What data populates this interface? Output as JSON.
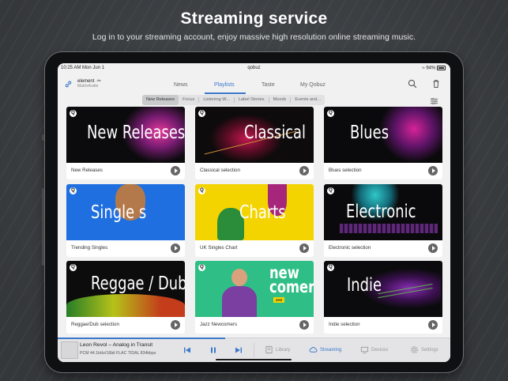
{
  "promo": {
    "title": "Streaming service",
    "subtitle": "Log in to your streaming account, enjoy massive high resolution online streaming music."
  },
  "status_bar": {
    "time": "10:25 AM   Mon Jun 1",
    "app_name": "qobuz",
    "battery": "94%"
  },
  "account": {
    "name": "element ·✂",
    "provider": "MatrixAudio"
  },
  "nav_tabs": [
    {
      "label": "News",
      "active": false
    },
    {
      "label": "Playlists",
      "active": true
    },
    {
      "label": "Taste",
      "active": false
    },
    {
      "label": "My Qobuz",
      "active": false
    }
  ],
  "filter_chips": [
    {
      "label": "New Releases",
      "selected": true
    },
    {
      "label": "Focus",
      "selected": false
    },
    {
      "label": "Listening W...",
      "selected": false
    },
    {
      "label": "Label Stories",
      "selected": false
    },
    {
      "label": "Moods",
      "selected": false
    },
    {
      "label": "Events and...",
      "selected": false
    }
  ],
  "playlists": [
    {
      "art_text": "New Releases",
      "caption": "New Releases",
      "bg": "#0b0b0d",
      "accent": "#e63a9a"
    },
    {
      "art_text": "Classical",
      "caption": "Classical selection",
      "bg": "#0d0b0b",
      "accent": "#c2184e"
    },
    {
      "art_text": "Blues",
      "caption": "Blues selection",
      "bg": "#0a0a0c",
      "accent": "#d6239a"
    },
    {
      "art_text": "Single s",
      "caption": "Trending Singles",
      "bg": "#1f6fe0",
      "accent": "#c47a3a"
    },
    {
      "art_text": "Charts",
      "caption": "UK Singles Chart",
      "bg": "#f4d400",
      "accent": "#2b8c3a"
    },
    {
      "art_text": "Electronic",
      "caption": "Electronic selection",
      "bg": "#0a0a0c",
      "accent": "#2fc7c7"
    },
    {
      "art_text": "Reggae / Dub",
      "caption": "Reggae/Dub selection",
      "bg": "#0c0c0c",
      "accent": "#c8d61a"
    },
    {
      "art_text": "new comers",
      "art_badge": "JAZ",
      "caption": "Jazz Newcomers",
      "bg": "#2fbf86",
      "accent": "#7a3fa1"
    },
    {
      "art_text": "Indie",
      "caption": "Indie selection",
      "bg": "#0b0b0d",
      "accent": "#8b2fb8"
    }
  ],
  "now_playing": {
    "title": "Leon Revol – Analog in Transit",
    "meta": "PCM  44.1kHz/16bit  FLAC  TIDAL  834kbps"
  },
  "bottom_tabs": [
    {
      "label": "Library",
      "icon": "library-icon",
      "active": false
    },
    {
      "label": "Streaming",
      "icon": "cloud-icon",
      "active": true
    },
    {
      "label": "Devices",
      "icon": "devices-icon",
      "active": false
    },
    {
      "label": "Settings",
      "icon": "gear-icon",
      "active": false
    }
  ],
  "colors": {
    "accent": "#3a78c9",
    "background": "#f1f1f2"
  }
}
